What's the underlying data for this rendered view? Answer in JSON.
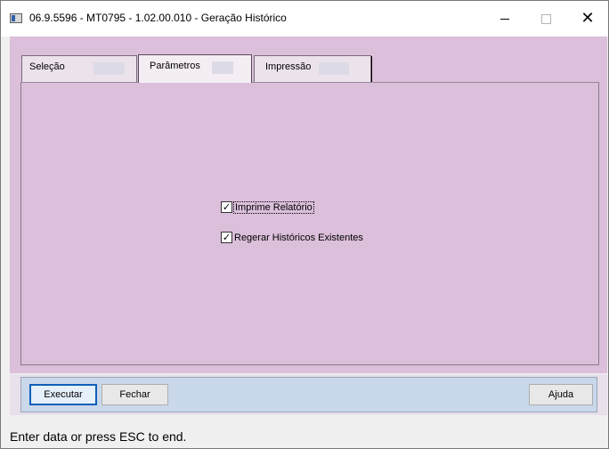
{
  "window": {
    "title": "06.9.5596 - MT0795 - 1.02.00.010 - Geração Histórico",
    "minimize_label": "—",
    "maximize_label": "☐",
    "close_label": "✕"
  },
  "tabs": [
    {
      "label": "Seleção",
      "active": false
    },
    {
      "label": "Parâmetros",
      "active": true
    },
    {
      "label": "Impressão",
      "active": false
    }
  ],
  "parametros": {
    "checkboxes": [
      {
        "label": "Imprime Relatório",
        "checked": true,
        "focused": true
      },
      {
        "label": "Regerar Históricos Existentes",
        "checked": true,
        "focused": false
      }
    ]
  },
  "buttons": {
    "executar": "Executar",
    "fechar": "Fechar",
    "ajuda": "Ajuda"
  },
  "status": {
    "text": "Enter data or press ESC to end."
  },
  "colors": {
    "panel": "#dbbfdb",
    "button_bar": "#c9d8ea",
    "default_button_border": "#0f5fb8"
  },
  "icons": {
    "check": "✓"
  }
}
